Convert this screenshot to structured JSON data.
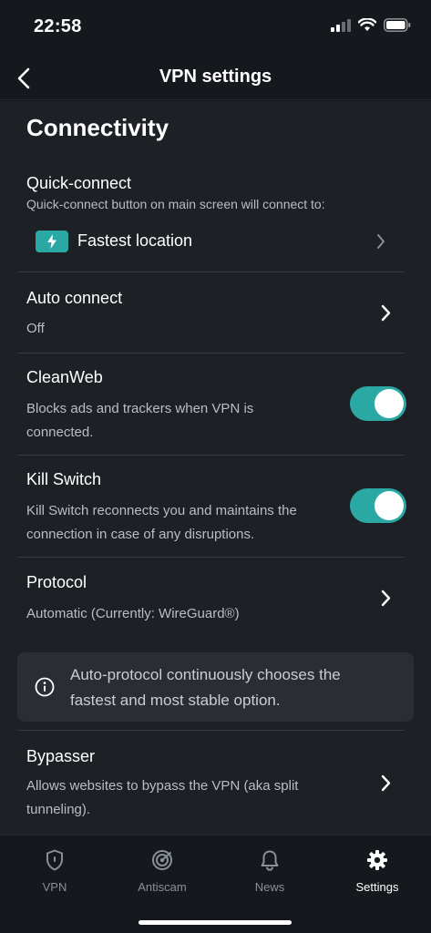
{
  "status_bar": {
    "time": "22:58"
  },
  "nav": {
    "title": "VPN settings"
  },
  "section": {
    "title": "Connectivity"
  },
  "quick_connect": {
    "title": "Quick-connect",
    "description": "Quick-connect button on main screen will connect to:",
    "value": "Fastest location"
  },
  "auto_connect": {
    "title": "Auto connect",
    "value": "Off"
  },
  "cleanweb": {
    "title": "CleanWeb",
    "description_line1": "Blocks ads and trackers when VPN is",
    "description_line2": "connected.",
    "enabled": true
  },
  "kill_switch": {
    "title": "Kill Switch",
    "description_line1": "Kill Switch reconnects you and maintains the",
    "description_line2": "connection in case of any disruptions.",
    "enabled": true
  },
  "protocol": {
    "title": "Protocol",
    "value": "Automatic (Currently: WireGuard®)"
  },
  "info": {
    "line1": "Auto-protocol continuously chooses the",
    "line2": "fastest and most stable option."
  },
  "bypasser": {
    "title": "Bypasser",
    "description_line1": "Allows websites to bypass the VPN (aka split",
    "description_line2": "tunneling)."
  },
  "tabs": [
    {
      "label": "VPN",
      "icon": "shield-icon",
      "active": false
    },
    {
      "label": "Antiscam",
      "icon": "radar-icon",
      "active": false
    },
    {
      "label": "News",
      "icon": "bell-icon",
      "active": false
    },
    {
      "label": "Settings",
      "icon": "gear-icon",
      "active": true
    }
  ],
  "colors": {
    "accent": "#2aa8a4",
    "background": "#1d2025",
    "bar": "#15181c"
  }
}
